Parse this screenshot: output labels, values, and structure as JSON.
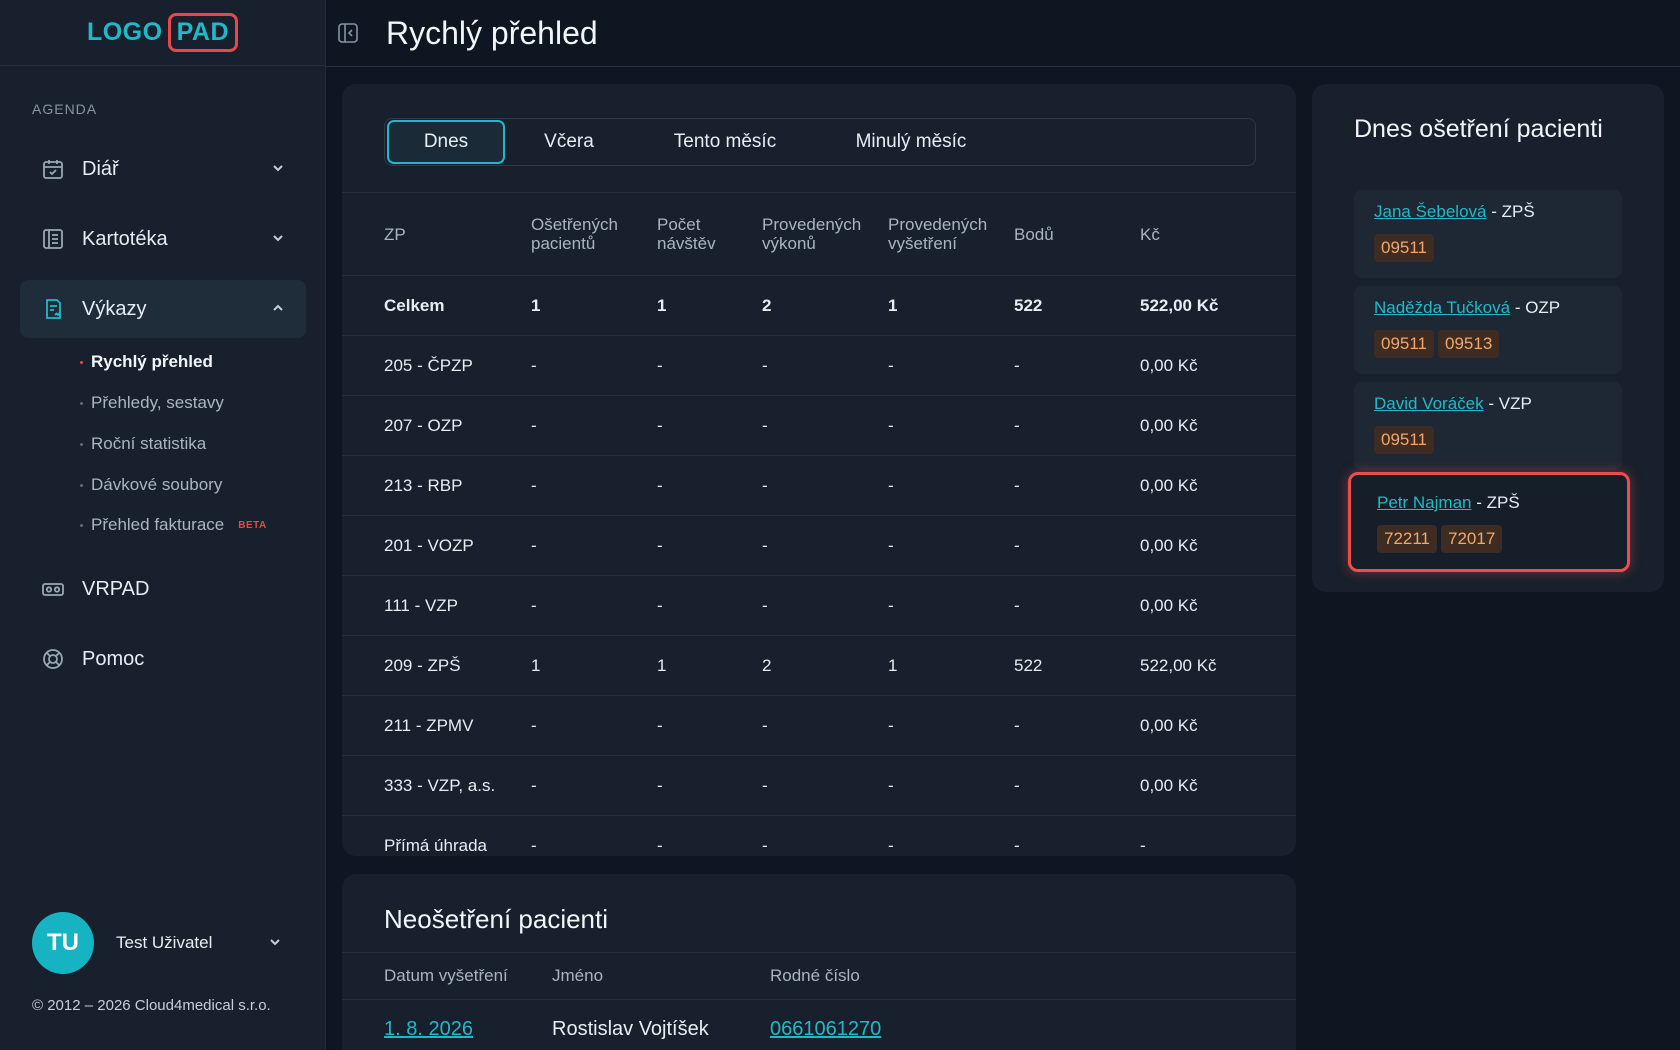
{
  "logo": {
    "part1": "LOGO",
    "part2": "PAD"
  },
  "sidebar": {
    "section_label": "AGENDA",
    "items": [
      {
        "label": "Diář",
        "icon": "calendar-icon",
        "expanded": false
      },
      {
        "label": "Kartotéka",
        "icon": "card-index-icon",
        "expanded": false
      },
      {
        "label": "Výkazy",
        "icon": "report-icon",
        "expanded": true
      }
    ],
    "sub_items": [
      {
        "label": "Rychlý přehled",
        "active": true
      },
      {
        "label": "Přehledy, sestavy"
      },
      {
        "label": "Roční statistika"
      },
      {
        "label": "Dávkové soubory"
      },
      {
        "label": "Přehled fakturace",
        "badge": "BETA"
      }
    ],
    "bottom_items": [
      {
        "label": "VRPAD",
        "icon": "vr-headset-icon"
      },
      {
        "label": "Pomoc",
        "icon": "lifebuoy-icon"
      }
    ],
    "user": {
      "initials": "TU",
      "name": "Test Uživatel"
    },
    "copyright": "© 2012 – 2026 Cloud4medical s.r.o."
  },
  "header": {
    "title": "Rychlý přehled"
  },
  "tabs": [
    "Dnes",
    "Včera",
    "Tento měsíc",
    "Minulý měsíc"
  ],
  "stats": {
    "headers": [
      "ZP",
      "Ošetřených pacientů",
      "Počet návštěv",
      "Provedených výkonů",
      "Provedených vyšetření",
      "Bodů",
      "Kč"
    ],
    "rows": [
      [
        "Celkem",
        "1",
        "1",
        "2",
        "1",
        "522",
        "522,00 Kč"
      ],
      [
        "205 - ČPZP",
        "-",
        "-",
        "-",
        "-",
        "-",
        "0,00 Kč"
      ],
      [
        "207 - OZP",
        "-",
        "-",
        "-",
        "-",
        "-",
        "0,00 Kč"
      ],
      [
        "213 - RBP",
        "-",
        "-",
        "-",
        "-",
        "-",
        "0,00 Kč"
      ],
      [
        "201 - VOZP",
        "-",
        "-",
        "-",
        "-",
        "-",
        "0,00 Kč"
      ],
      [
        "111 - VZP",
        "-",
        "-",
        "-",
        "-",
        "-",
        "0,00 Kč"
      ],
      [
        "209 - ZPŠ",
        "1",
        "1",
        "2",
        "1",
        "522",
        "522,00 Kč"
      ],
      [
        "211 - ZPMV",
        "-",
        "-",
        "-",
        "-",
        "-",
        "0,00 Kč"
      ],
      [
        "333 - VZP, a.s.",
        "-",
        "-",
        "-",
        "-",
        "-",
        "0,00 Kč"
      ],
      [
        "Přímá úhrada",
        "-",
        "-",
        "-",
        "-",
        "-",
        "-"
      ]
    ]
  },
  "untreated": {
    "title": "Neošetření pacienti",
    "headers": [
      "Datum vyšetření",
      "Jméno",
      "Rodné číslo"
    ],
    "rows": [
      [
        "1. 8. 2026",
        "Rostislav Vojtíšek",
        "0661061270"
      ]
    ]
  },
  "today_patients": {
    "title": "Dnes ošetření pacienti",
    "patients": [
      {
        "name": "Jana Šebelová",
        "insurer": "ZPŠ",
        "codes": [
          "09511"
        ]
      },
      {
        "name": "Naděžda Tučková",
        "insurer": "OZP",
        "codes": [
          "09511",
          "09513"
        ]
      },
      {
        "name": "David Voráček",
        "insurer": "VZP",
        "codes": [
          "09511"
        ]
      },
      {
        "name": "Petr Najman",
        "insurer": "ZPŠ",
        "codes": [
          "72211",
          "72017"
        ]
      }
    ]
  }
}
